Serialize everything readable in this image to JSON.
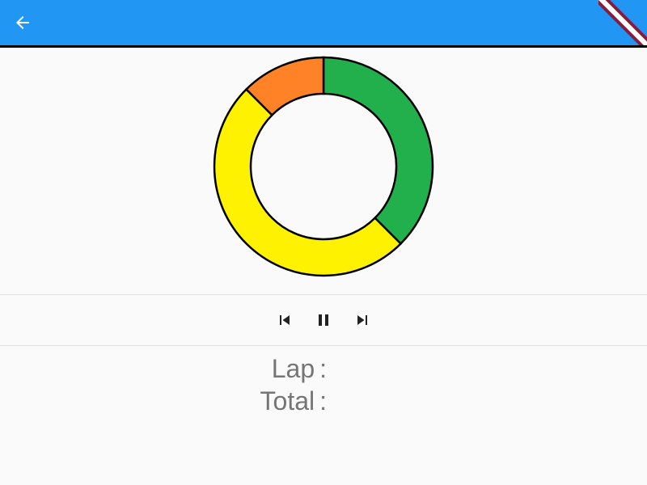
{
  "app_bar": {
    "color": "#2196f3",
    "back_icon": "arrow-back-icon",
    "debug_banner_icon": "debug-banner-ribbon"
  },
  "chart_data": {
    "type": "pie",
    "variant": "donut",
    "categories": [
      "segment-1",
      "segment-2",
      "segment-3"
    ],
    "values": [
      37.5,
      50,
      12.5
    ],
    "colors": [
      "#21b04b",
      "#fff200",
      "#ff8326"
    ],
    "start_angle_deg": 0,
    "direction": "clockwise"
  },
  "controls": {
    "previous_icon": "skip-previous-icon",
    "pause_icon": "pause-icon",
    "next_icon": "skip-next-icon"
  },
  "stats": {
    "lap_label": "Lap",
    "lap_sep": ":",
    "total_label": "Total",
    "total_sep": ":"
  }
}
